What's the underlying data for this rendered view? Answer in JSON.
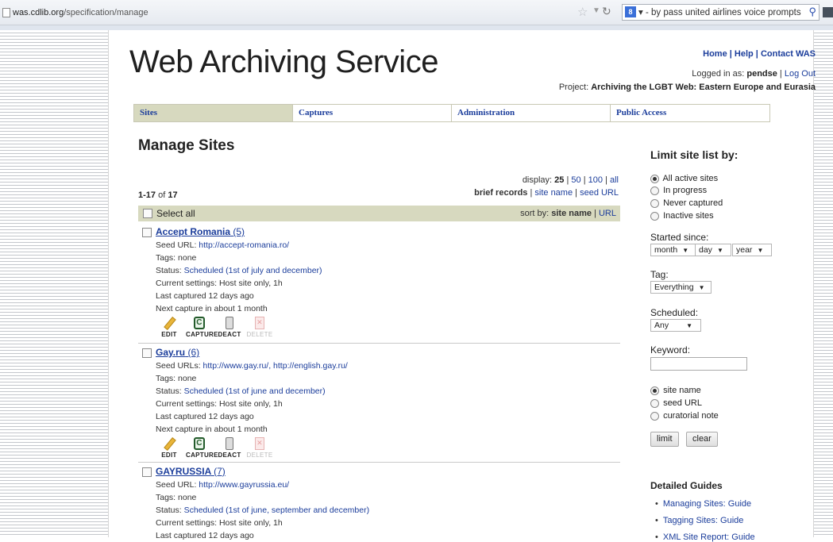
{
  "browser": {
    "url_domain": "was.cdlib.org",
    "url_path": "/specification/manage",
    "search_query": "by pass united airlines voice prompts"
  },
  "header": {
    "logo": "Web Archiving Service",
    "home_link": "Home",
    "help_link": "Help",
    "contact_link": "Contact WAS",
    "logged_in_prefix": "Logged in as:",
    "username": "pendse",
    "logout_link": "Log Out",
    "project_prefix": "Project:",
    "project_name": "Archiving the LGBT Web: Eastern Europe and Eurasia"
  },
  "tabs": [
    "Sites",
    "Captures",
    "Administration",
    "Public Access"
  ],
  "main": {
    "title": "Manage Sites",
    "display_label": "display:",
    "display_options": [
      "25",
      "50",
      "100",
      "all"
    ],
    "brief_records": "brief records",
    "site_name_link": "site name",
    "seed_url_link": "seed URL",
    "count_range": "1-17",
    "count_of": "of",
    "count_total": "17",
    "select_all": "Select all",
    "sort_label": "sort by:",
    "sort_active": "site name",
    "sort_other": "URL"
  },
  "actions": [
    "EDIT",
    "CAPTURE",
    "DEACT",
    "DELETE"
  ],
  "sites": [
    {
      "name": "Accept Romania",
      "count": "(5)",
      "seed_label": "Seed URL:",
      "seed_urls": "http://accept-romania.ro/",
      "tags": "Tags: none",
      "status_label": "Status:",
      "status": "Scheduled (1st of july and december)",
      "settings": "Current settings: Host site only, 1h",
      "last_captured": "Last captured 12 days ago",
      "next_capture": "Next capture in about 1 month"
    },
    {
      "name": "Gay.ru",
      "count": "(6)",
      "seed_label": "Seed URLs:",
      "seed_urls": "http://www.gay.ru/, http://english.gay.ru/",
      "tags": "Tags: none",
      "status_label": "Status:",
      "status": "Scheduled (1st of june and december)",
      "settings": "Current settings: Host site only, 1h",
      "last_captured": "Last captured 12 days ago",
      "next_capture": "Next capture in about 1 month"
    },
    {
      "name": "GAYRUSSIA",
      "count": "(7)",
      "seed_label": "Seed URL:",
      "seed_urls": "http://www.gayrussia.eu/",
      "tags": "Tags: none",
      "status_label": "Status:",
      "status": "Scheduled (1st of june, september and december)",
      "settings": "Current settings: Host site only, 1h",
      "last_captured": "Last captured 12 days ago"
    }
  ],
  "sidebar": {
    "title": "Limit site list by:",
    "status_options": [
      "All active sites",
      "In progress",
      "Never captured",
      "Inactive sites"
    ],
    "started_since_label": "Started since:",
    "month": "month",
    "day": "day",
    "year": "year",
    "tag_label": "Tag:",
    "tag_value": "Everything",
    "scheduled_label": "Scheduled:",
    "scheduled_value": "Any",
    "keyword_label": "Keyword:",
    "keyword_value": "",
    "search_field_options": [
      "site name",
      "seed URL",
      "curatorial note"
    ],
    "limit_button": "limit",
    "clear_button": "clear",
    "guides_title": "Detailed Guides",
    "guides": [
      "Managing Sites: Guide",
      "Tagging Sites: Guide",
      "XML Site Report: Guide"
    ]
  }
}
